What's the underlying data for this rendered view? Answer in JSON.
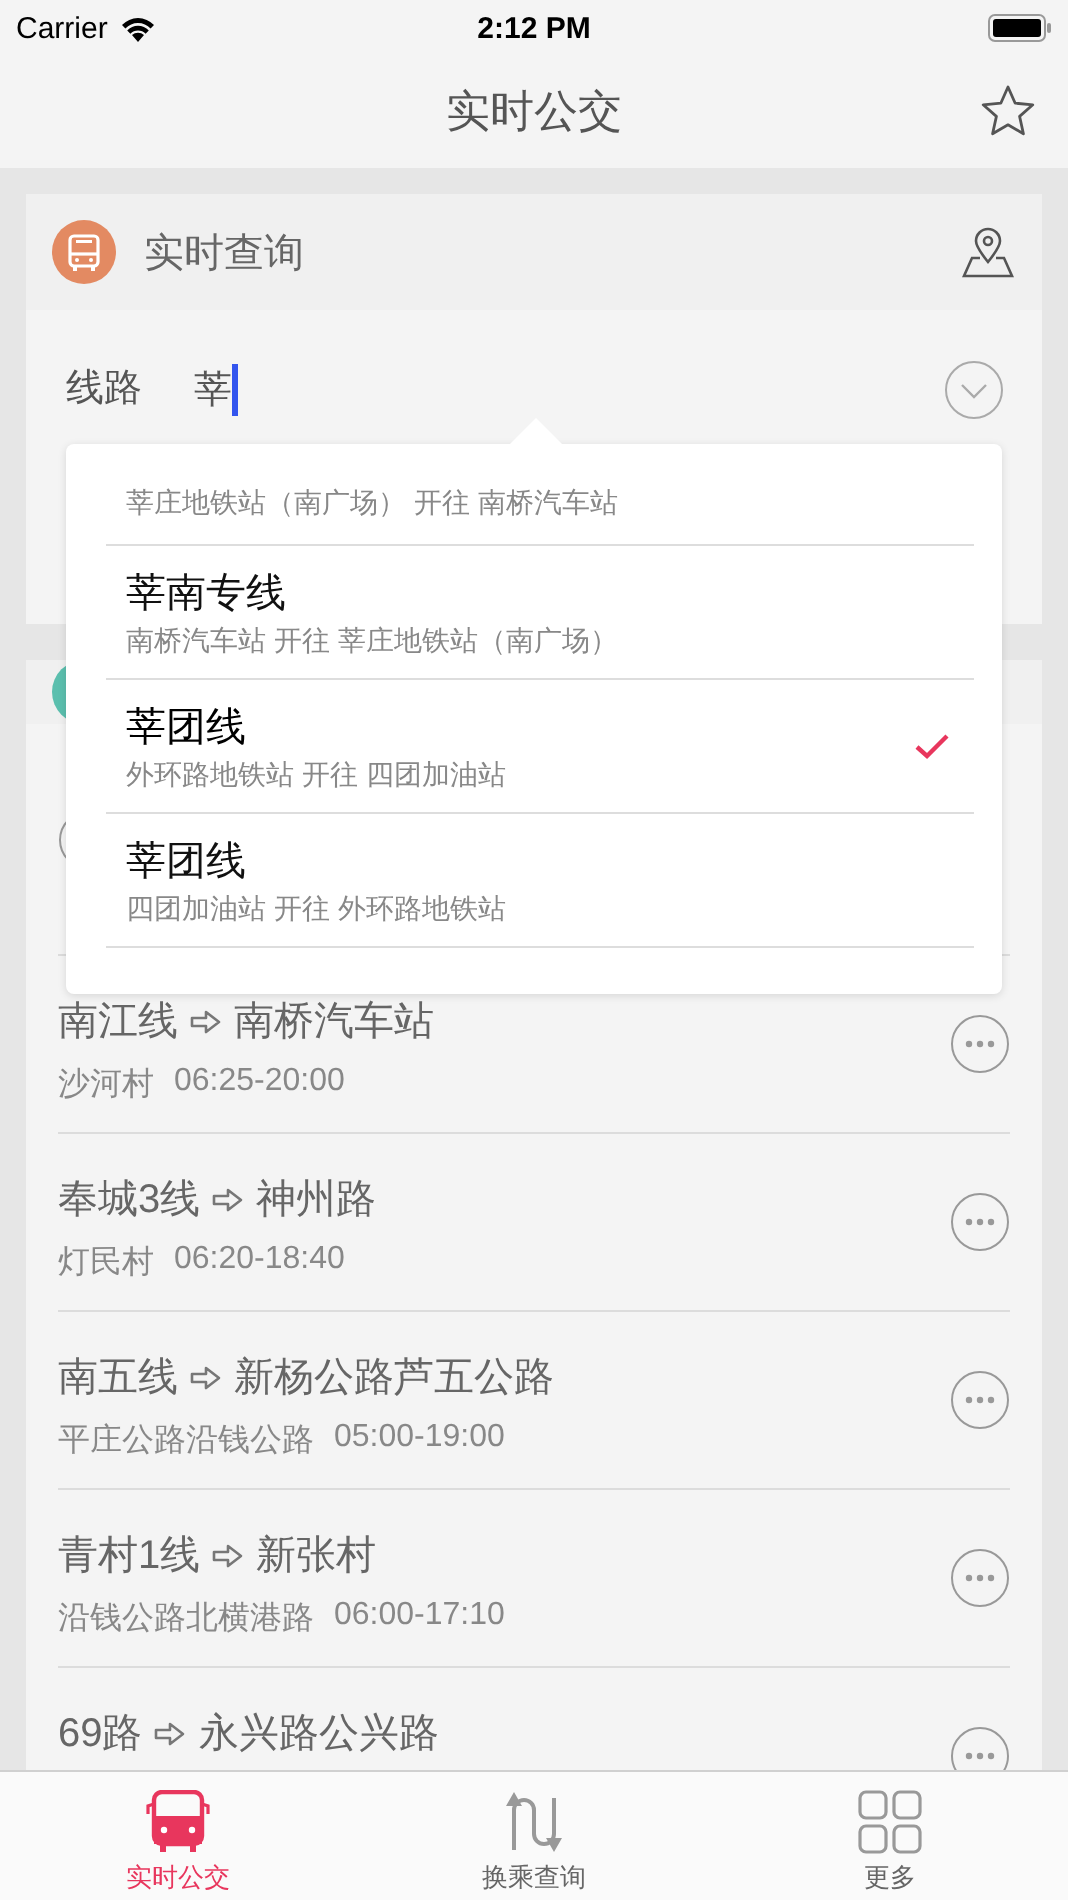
{
  "status_bar": {
    "carrier": "Carrier",
    "time": "2:12 PM"
  },
  "nav": {
    "title": "实时公交"
  },
  "query_card": {
    "title": "实时查询",
    "field_label": "线路",
    "field_value": "莘"
  },
  "dropdown": {
    "items": [
      {
        "route": "莘庄地铁站（南广场） 开往 南桥汽车站",
        "selected": false
      },
      {
        "name": "莘南专线",
        "route": "南桥汽车站 开往 莘庄地铁站（南广场）",
        "selected": false
      },
      {
        "name": "莘团线",
        "route": "外环路地铁站 开往 四团加油站",
        "selected": true
      },
      {
        "name": "莘团线",
        "route": "四团加油站 开往 外环路地铁站",
        "selected": false
      }
    ]
  },
  "routes": [
    {
      "line": "南江线",
      "destination": "南桥汽车站",
      "stop": "沙河村",
      "hours": "06:25-20:00"
    },
    {
      "line": "奉城3线",
      "destination": "神州路",
      "stop": "灯民村",
      "hours": "06:20-18:40"
    },
    {
      "line": "南五线",
      "destination": "新杨公路芦五公路",
      "stop": "平庄公路沿钱公路",
      "hours": "05:00-19:00"
    },
    {
      "line": "青村1线",
      "destination": "新张村",
      "stop": "沿钱公路北横港路",
      "hours": "06:00-17:10"
    },
    {
      "line": "69路",
      "destination": "永兴路公兴路"
    }
  ],
  "tabs": [
    {
      "label": "实时公交",
      "kind": "bus",
      "selected": true
    },
    {
      "label": "换乘查询",
      "kind": "transfer",
      "selected": false
    },
    {
      "label": "更多",
      "kind": "grid",
      "selected": false
    }
  ]
}
